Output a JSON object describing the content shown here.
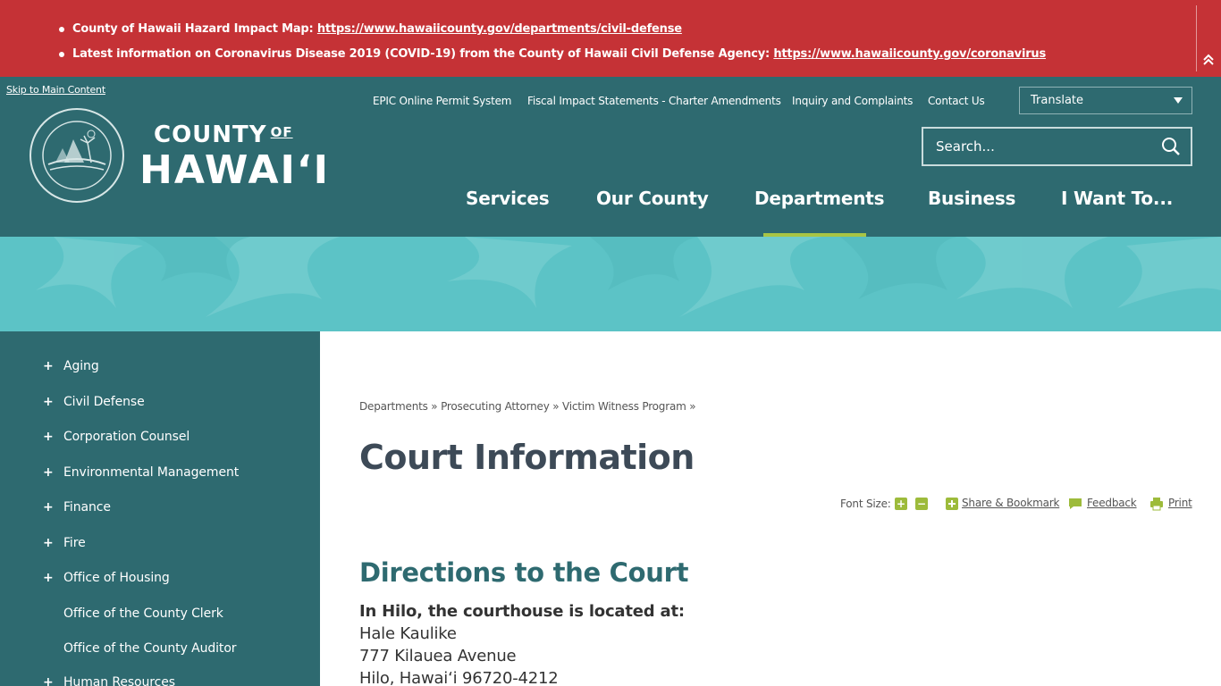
{
  "alerts": [
    {
      "label": "County of Hawaii Hazard Impact Map:",
      "link": "https://www.hawaiicounty.gov/departments/civil-defense"
    },
    {
      "label": "Latest information on Coronavirus Disease 2019 (COVID-19) from the County of Hawaii Civil Defense Agency:",
      "link": "https://www.hawaiicounty.gov/coronavirus"
    }
  ],
  "header": {
    "skip_link": "Skip to Main Content",
    "logo_county": "COUNTY",
    "logo_of": "OF",
    "logo_hawaii": "HAWAI‘I",
    "utility_links": [
      "EPIC Online Permit System",
      "Fiscal Impact Statements - Charter Amendments",
      "Inquiry and Complaints",
      "Contact Us"
    ],
    "translate_label": "Translate",
    "search_placeholder": "Search...",
    "nav": [
      "Services",
      "Our County",
      "Departments",
      "Business",
      "I Want To..."
    ],
    "active_nav": "Departments"
  },
  "sidebar": {
    "items": [
      {
        "label": "Aging",
        "expandable": true
      },
      {
        "label": "Civil Defense",
        "expandable": true
      },
      {
        "label": "Corporation Counsel",
        "expandable": true
      },
      {
        "label": "Environmental Management",
        "expandable": true
      },
      {
        "label": "Finance",
        "expandable": true
      },
      {
        "label": "Fire",
        "expandable": true
      },
      {
        "label": "Office of Housing",
        "expandable": true
      },
      {
        "label": "Office of the County Clerk",
        "expandable": false
      },
      {
        "label": "Office of the County Auditor",
        "expandable": false
      },
      {
        "label": "Human Resources",
        "expandable": true
      }
    ],
    "plus_symbol": "+"
  },
  "main": {
    "breadcrumb": [
      "Departments",
      "Prosecuting Attorney",
      "Victim Witness Program"
    ],
    "breadcrumb_sep": "»",
    "title": "Court Information",
    "tools": {
      "font_size_label": "Font Size:",
      "increase": "+",
      "decrease": "−",
      "share": "Share & Bookmark",
      "feedback": "Feedback",
      "print": "Print"
    },
    "section_heading": "Directions to the Court",
    "address_lead": "In Hilo, the courthouse is located at:",
    "address_lines": [
      "Hale Kaulike",
      "777 Kilauea Avenue",
      "Hilo, Hawai‘i 96720-4212"
    ]
  },
  "colors": {
    "alert_bg": "#c53236",
    "header_bg": "#2e6a70",
    "banner_bg": "#5cc3c6",
    "accent_green": "#9dbb3b",
    "title_color": "#3d4a57"
  }
}
